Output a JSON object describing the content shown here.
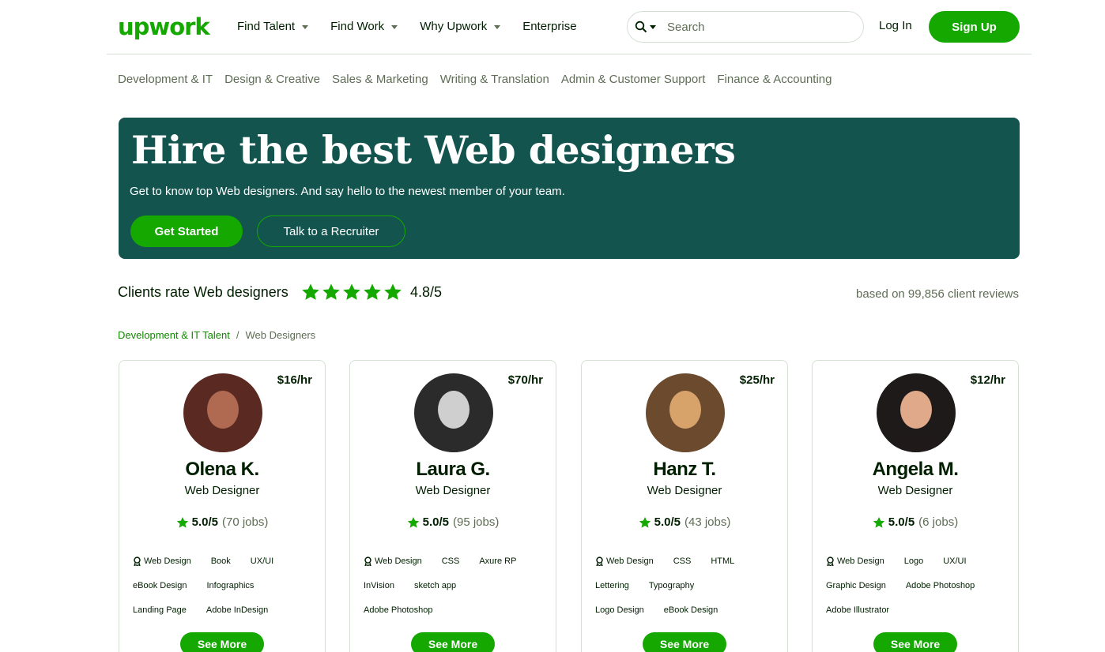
{
  "header": {
    "logo_text": "upwork",
    "nav": [
      {
        "label": "Find Talent",
        "has_caret": true
      },
      {
        "label": "Find Work",
        "has_caret": true
      },
      {
        "label": "Why Upwork",
        "has_caret": true
      },
      {
        "label": "Enterprise",
        "has_caret": false
      }
    ],
    "search_placeholder": "Search",
    "login": "Log In",
    "signup": "Sign Up"
  },
  "categories": [
    "Development & IT",
    "Design & Creative",
    "Sales & Marketing",
    "Writing & Translation",
    "Admin & Customer Support",
    "Finance & Accounting"
  ],
  "hero": {
    "title": "Hire the best Web designers",
    "subtitle": "Get to know top Web designers. And say hello to the newest member of your team.",
    "primary_button": "Get Started",
    "secondary_button": "Talk to a Recruiter"
  },
  "rating": {
    "label": "Clients rate Web designers",
    "stars": 5,
    "score": "4.8/5",
    "based_on": "based on 99,856 client reviews"
  },
  "breadcrumb": {
    "link": "Development & IT Talent",
    "separator": "/",
    "current": "Web Designers"
  },
  "cards": [
    {
      "rate": "$16/hr",
      "name": "Olena K.",
      "title": "Web Designer",
      "score": "5.0/5",
      "jobs": "(70 jobs)",
      "skills": [
        [
          "Web Design",
          "Book",
          "UX/UI"
        ],
        [
          "eBook Design",
          "Infographics"
        ],
        [
          "Landing Page",
          "Adobe InDesign"
        ]
      ],
      "see_more": "See More",
      "avatar_colors": [
        "#5a2a22",
        "#b06a52"
      ]
    },
    {
      "rate": "$70/hr",
      "name": "Laura G.",
      "title": "Web Designer",
      "score": "5.0/5",
      "jobs": "(95 jobs)",
      "skills": [
        [
          "Web Design",
          "CSS",
          "Axure RP"
        ],
        [
          "InVision",
          "sketch app"
        ],
        [
          "Adobe Photoshop"
        ]
      ],
      "see_more": "See More",
      "avatar_colors": [
        "#2b2b2b",
        "#cfcfcf"
      ]
    },
    {
      "rate": "$25/hr",
      "name": "Hanz T.",
      "title": "Web Designer",
      "score": "5.0/5",
      "jobs": "(43 jobs)",
      "skills": [
        [
          "Web Design",
          "CSS",
          "HTML"
        ],
        [
          "Lettering",
          "Typography"
        ],
        [
          "Logo Design",
          "eBook Design"
        ]
      ],
      "see_more": "See More",
      "avatar_colors": [
        "#6b4a2e",
        "#d7a36a"
      ]
    },
    {
      "rate": "$12/hr",
      "name": "Angela M.",
      "title": "Web Designer",
      "score": "5.0/5",
      "jobs": "(6 jobs)",
      "skills": [
        [
          "Web Design",
          "Logo",
          "UX/UI"
        ],
        [
          "Graphic Design",
          "Adobe Photoshop"
        ],
        [
          "Adobe Illustrator"
        ]
      ],
      "see_more": "See More",
      "avatar_colors": [
        "#1f1a1a",
        "#e0a98a"
      ]
    }
  ],
  "colors": {
    "brand_green": "#14a800",
    "hero_bg": "#13544e",
    "star_green": "#14a800"
  }
}
